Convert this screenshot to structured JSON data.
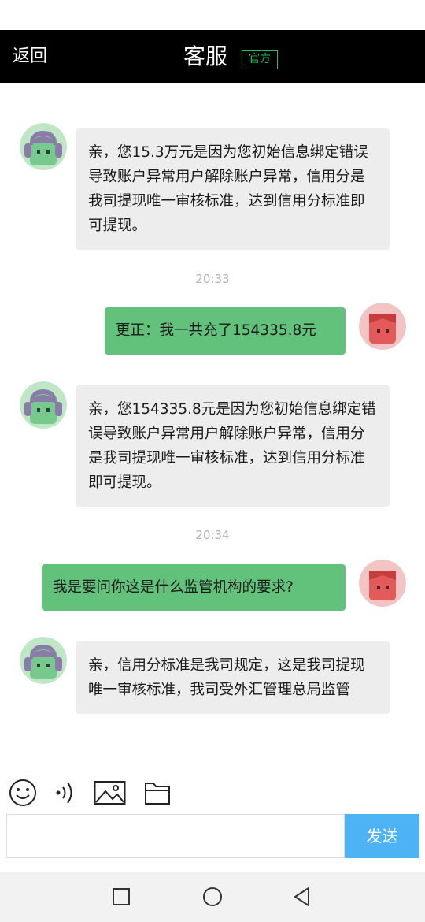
{
  "header": {
    "back_label": "返回",
    "title": "客服",
    "badge": "官方"
  },
  "colors": {
    "header_bg": "#000000",
    "badge": "#19c25a",
    "incoming_bubble": "#ededed",
    "outgoing_bubble": "#62c17a",
    "send_button": "#4db3f5"
  },
  "messages": [
    {
      "from": "agent",
      "text": "亲，您15.3万元是因为您初始信息绑定错误导致账户异常用户解除账户异常，信用分是我司提现唯一审核标准，达到信用分标准即可提现。"
    },
    {
      "time": "20:33"
    },
    {
      "from": "user",
      "text": "更正：我一共充了154335.8元"
    },
    {
      "from": "agent",
      "text": "亲，您154335.8元是因为您初始信息绑定错误导致账户异常用户解除账户异常，信用分是我司提现唯一审核标准，达到信用分标准即可提现。"
    },
    {
      "time": "20:34"
    },
    {
      "from": "user",
      "text": "我是要问你这是什么监管机构的要求?"
    },
    {
      "from": "agent",
      "text": "亲，信用分标准是我司规定，这是我司提现唯一审核标准，我司受外汇管理总局监管"
    }
  ],
  "toolbar": {
    "icons": [
      "emoji-icon",
      "voice-icon",
      "image-icon",
      "folder-icon"
    ]
  },
  "composer": {
    "input_value": "",
    "send_label": "发送"
  },
  "navbar": {
    "icons": [
      "recent-apps-icon",
      "home-icon",
      "back-icon"
    ]
  }
}
